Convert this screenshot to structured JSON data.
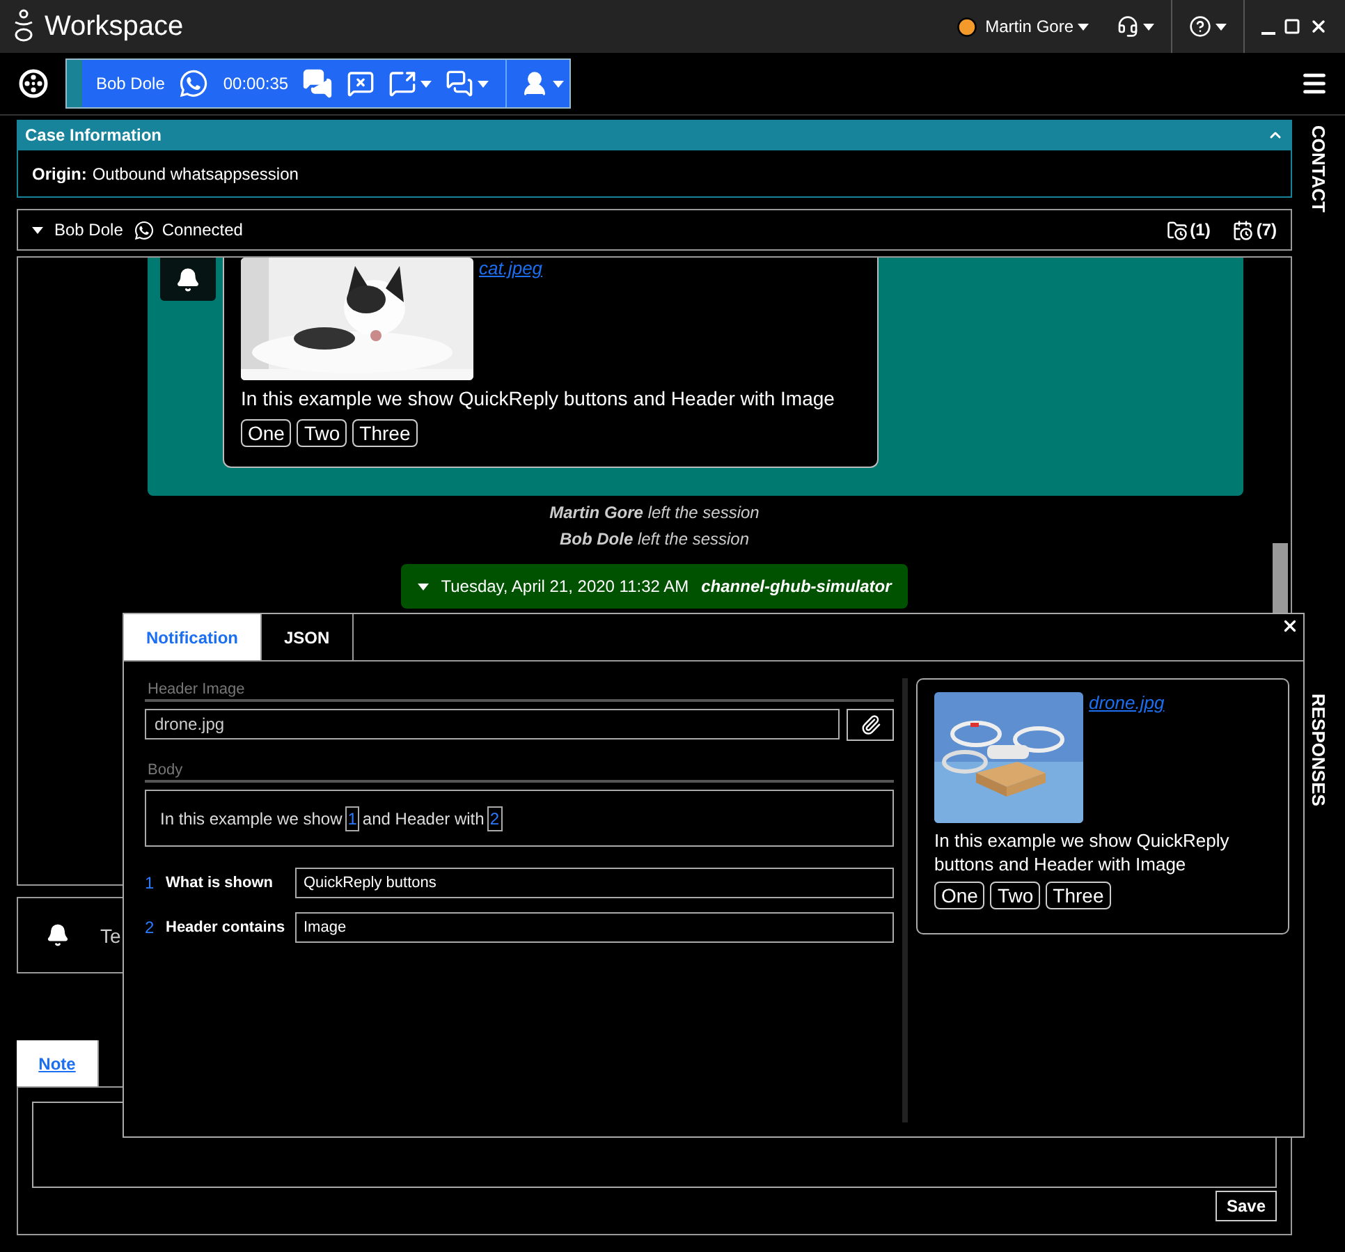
{
  "window": {
    "title": "Workspace",
    "user": "Martin Gore"
  },
  "interaction_bar": {
    "contact": "Bob Dole",
    "timer": "00:00:35"
  },
  "side_tabs": [
    "CONTACT",
    "RESPONSES"
  ],
  "case_information": {
    "title": "Case Information",
    "expanded": true,
    "fields": [
      {
        "label": "Origin:",
        "value": "Outbound whatsappsession"
      }
    ]
  },
  "interaction": {
    "contact": "Bob Dole",
    "status": "Connected",
    "counts": [
      {
        "kind": "folder",
        "text": "(1)"
      },
      {
        "kind": "history",
        "text": "(7)"
      }
    ]
  },
  "transcript": {
    "message": {
      "attachment": "cat.jpeg",
      "text": "In this example we show QuickReply buttons and Header with Image",
      "quick_replies": [
        "One",
        "Two",
        "Three"
      ]
    },
    "events": [
      {
        "actor": "Martin Gore",
        "text": "left the session"
      },
      {
        "actor": "Bob Dole",
        "text": "left the session"
      }
    ],
    "session": {
      "date": "Tuesday, April 21, 2020 11:32 AM",
      "channel": "channel-ghub-simulator"
    }
  },
  "notice": {
    "text": "Te"
  },
  "note": {
    "tabs": [
      {
        "label": "Note",
        "selected": true
      }
    ],
    "button": "Save"
  },
  "dialog": {
    "tabs": [
      {
        "label": "Notification",
        "selected": true
      },
      {
        "label": "JSON",
        "selected": false
      }
    ],
    "header_label": "Header Image",
    "header_value": "drone.jpg",
    "body_label": "Body",
    "body": [
      {
        "kind": "text",
        "text": "In this example we show"
      },
      {
        "kind": "placeholder",
        "text": "1"
      },
      {
        "kind": "text",
        "text": "and Header with"
      },
      {
        "kind": "placeholder",
        "text": "2"
      }
    ],
    "parameters": [
      {
        "index": "1",
        "label": "What is shown",
        "value": "QuickReply buttons"
      },
      {
        "index": "2",
        "label": "Header contains",
        "value": "Image"
      }
    ],
    "preview": {
      "attachment": "drone.jpg",
      "text": "In this example we show QuickReply buttons and Header with Image",
      "quick_replies": [
        "One",
        "Two",
        "Three"
      ]
    }
  }
}
